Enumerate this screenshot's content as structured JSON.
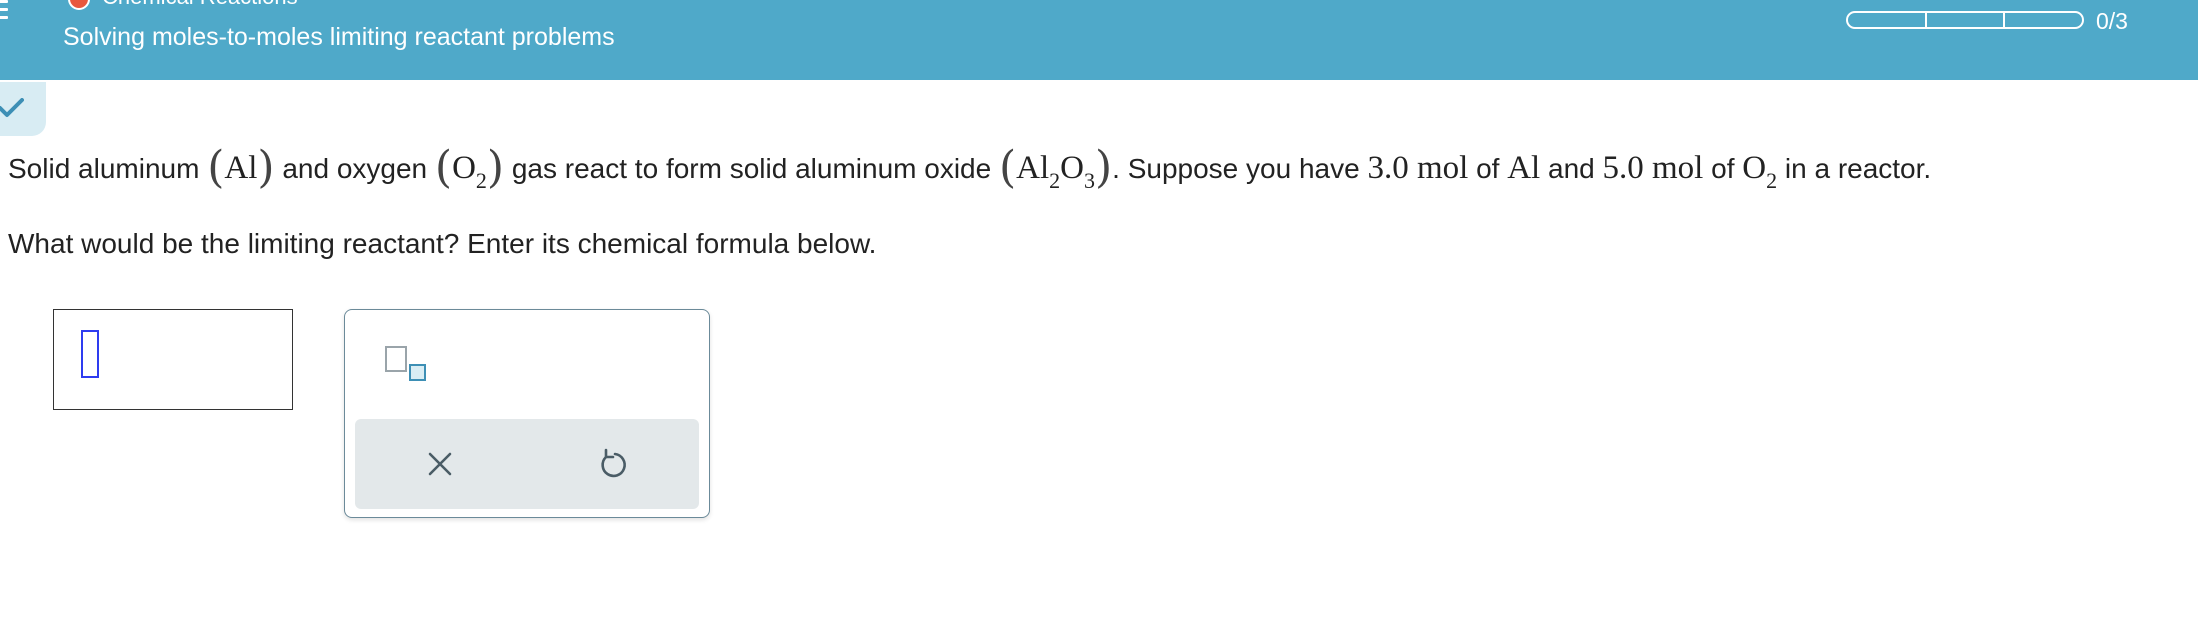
{
  "header": {
    "topic": "Chemical Reactions",
    "title": "Solving moles-to-moles limiting reactant problems",
    "progress": {
      "segments": 3,
      "completed": 0,
      "count_text": "0/3"
    },
    "colors": {
      "background": "#4fa9c9",
      "topic_dot": "#e8573d"
    }
  },
  "question": {
    "t1": "Solid aluminum ",
    "al": "Al",
    "t2": " and oxygen ",
    "o2_o": "O",
    "o2_sub": "2",
    "t3": " gas react to form solid aluminum oxide ",
    "al2o3_al": "Al",
    "al2o3_sub1": "2",
    "al2o3_o": "O",
    "al2o3_sub2": "3",
    "t4": ". Suppose you have ",
    "qty1": "3.0 mol",
    "t5": " of ",
    "al_b": "Al",
    "t6": " and ",
    "qty2": "5.0 mol",
    "t7": " of ",
    "o2b_o": "O",
    "o2b_sub": "2",
    "t8": " in a reactor."
  },
  "prompt": "What would be the limiting reactant? Enter its chemical formula below.",
  "answer": {
    "value": ""
  },
  "palette": {
    "tools": [
      "subscript-tool"
    ],
    "actions": [
      "clear-icon",
      "undo-icon"
    ]
  }
}
